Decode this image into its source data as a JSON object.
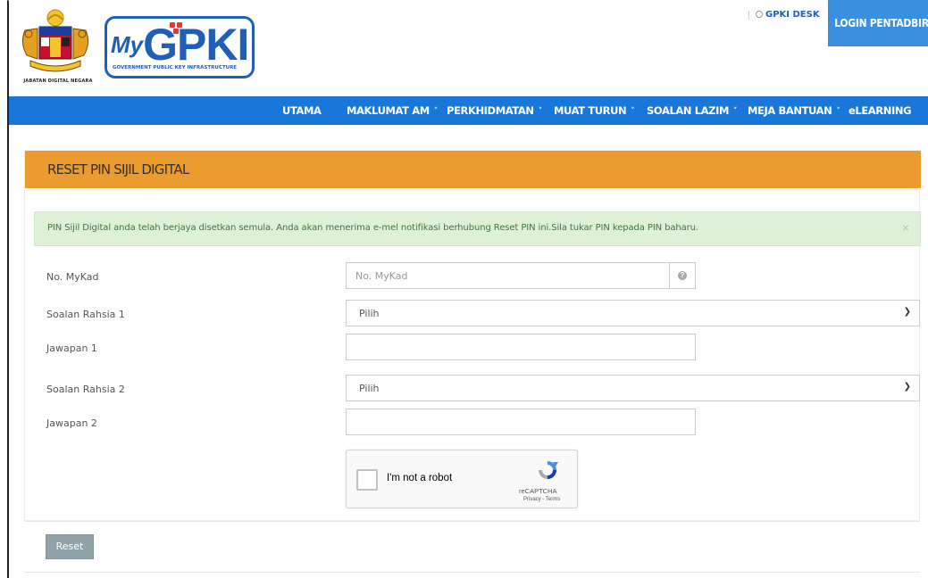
{
  "header": {
    "crest_label": "JABATAN DIGITAL NEGARA",
    "logo": {
      "my": "My",
      "gpki": "GPKI",
      "subtitle": "GOVERNMENT PUBLIC KEY INFRASTRUCTURE"
    },
    "gpki_desk": "GPKI DESK",
    "login_label": "LOGIN PENTADBIR"
  },
  "nav": {
    "items": [
      {
        "label": "UTAMA",
        "has_dropdown": false
      },
      {
        "label": "MAKLUMAT AM",
        "has_dropdown": true
      },
      {
        "label": "PERKHIDMATAN",
        "has_dropdown": true
      },
      {
        "label": "MUAT TURUN",
        "has_dropdown": true
      },
      {
        "label": "SOALAN LAZIM",
        "has_dropdown": true
      },
      {
        "label": "MEJA BANTUAN",
        "has_dropdown": true
      },
      {
        "label": "eLEARNING",
        "has_dropdown": false
      }
    ],
    "chevron": "˅"
  },
  "panel": {
    "title": "RESET PIN SIJIL DIGITAL",
    "alert": "PIN Sijil Digital anda telah berjaya disetkan semula. Anda akan menerima e-mel notifikasi berhubung Reset PIN ini.Sila tukar PIN kepada PIN baharu.",
    "alert_close": "×"
  },
  "form": {
    "mykad": {
      "label": "No. MyKad",
      "placeholder": "No. MyKad",
      "value": ""
    },
    "soalan1": {
      "label": "Soalan Rahsia 1",
      "selected": "Pilih"
    },
    "jawapan1": {
      "label": "Jawapan 1",
      "value": ""
    },
    "soalan2": {
      "label": "Soalan Rahsia 2",
      "selected": "Pilih"
    },
    "jawapan2": {
      "label": "Jawapan 2",
      "value": ""
    },
    "select_chevron": "⌄"
  },
  "captcha": {
    "text": "I'm not a robot",
    "brand": "reCAPTCHA",
    "links": "Privacy - Terms"
  },
  "actions": {
    "reset_label": "Reset"
  },
  "colors": {
    "nav": "#1877d8",
    "panel_header": "#ec9b2e",
    "alert_bg": "#dff0d8",
    "login": "#3a8fe0",
    "reset": "#8fa3a8"
  }
}
